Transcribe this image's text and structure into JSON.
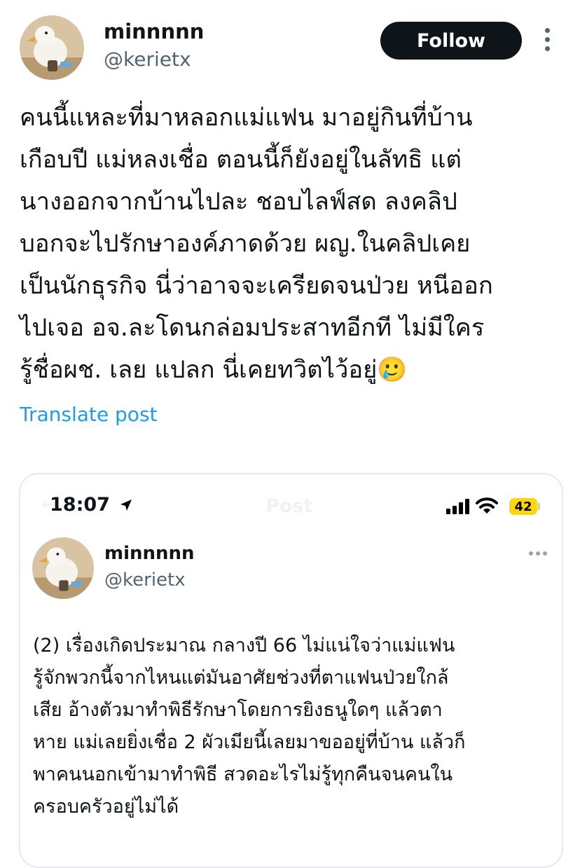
{
  "author": {
    "name": "minnnnn",
    "handle": "@kerietx",
    "follow_label": "Follow"
  },
  "icons": {
    "more_vertical": "more-vertical-icon",
    "location_arrow": "location-arrow-icon",
    "signal": "cellular-signal-icon",
    "wifi": "wifi-icon",
    "more_horizontal": "more-horizontal-icon"
  },
  "post": {
    "lines": [
      "คนนี้แหละที่มาหลอกแม่แฟน มาอยู่กินที่บ้าน",
      "เกือบปี แม่หลงเชื่อ ตอนนี้ก็ยังอยู่ในลัทธิ แต่",
      "นางออกจากบ้านไปละ ชอบไลฟ์สด ลงคลิป",
      "บอกจะไปรักษาองค์ภาดด้วย ผญ.ในคลิปเคย",
      "เป็นนักธุรกิจ นี่ว่าอาจจะเครียดจนป่วย หนีออก",
      "ไปเจอ อจ.ละโดนกล่อมประสาทอีกที ไม่มีใคร",
      "รู้ชื่อผช. เลย แปลก นี่เคยทวิตไว้อยู่🥲"
    ],
    "translate_label": "Translate post"
  },
  "screenshot": {
    "status_time": "18:07",
    "battery": "42",
    "ghost_title": "Post",
    "name": "minnnnn",
    "handle": "@kerietx",
    "lines": [
      "(2) เรื่องเกิดประมาณ กลางปี 66 ไม่แน่ใจว่าแม่แฟน",
      "รู้จักพวกนี้จากไหนแต่มันอาศัยช่วงที่ตาแฟนป่วยใกล้",
      "เสีย อ้างตัวมาทำพิธีรักษาโดยการยิงธนูใดๆ แล้วตา",
      "หาย แม่เลยยิ่งเชื่อ 2 ผัวเมียนี้เลยมาขออยู่ที่บ้าน แล้วก็",
      "พาคนนอกเข้ามาทำพิธี สวดอะไรไม่รู้ทุกคืนจนคนใน",
      "ครอบครัวอยู่ไม่ได้"
    ]
  },
  "colors": {
    "link": "#1d9bf0",
    "follow_bg": "#0f1419",
    "battery": "#ffd60a"
  }
}
